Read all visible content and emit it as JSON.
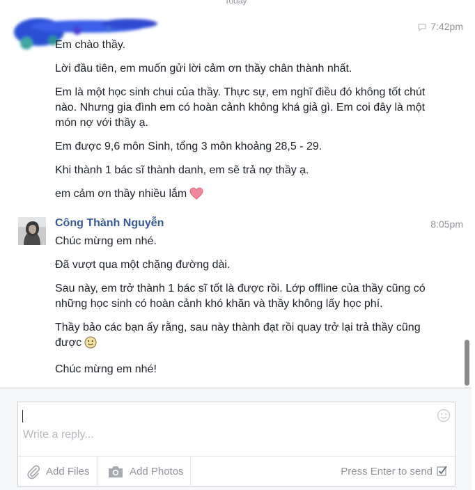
{
  "thread": {
    "day_separator": "Today",
    "messages": [
      {
        "sender": "",
        "time": "7:42pm",
        "lines": [
          "Em chào thầy.",
          "Lời đầu tiên, em muốn gửi lời cảm ơn thầy chân thành nhất.",
          "Em là một học sinh chui của thầy. Thực sự, em nghĩ điều đó không tốt chút nào. Nhưng gia đình em có hoàn cảnh không khá giả gì. Em coi đây là một món nợ với thầy ạ.",
          "Em được 9,6 môn Sinh, tổng 3 môn khoảng 28,5 - 29.",
          "Khi thành 1 bác sĩ thành danh, em sẽ trả nợ thầy ạ.",
          "em cảm ơn thầy nhiều lắm"
        ],
        "emoji_last_line": "heart-icon"
      },
      {
        "sender": "Công Thành Nguyễn",
        "time": "8:05pm",
        "lines": [
          "Chúc mừng em nhé.",
          "Đã vượt qua một chặng đường dài.",
          "Sau này, em trở thành 1 bác sĩ tốt là được rồi. Lớp offline của thầy cũng có những học sinh có hoàn cảnh khó khăn và thầy không lấy học phí.",
          "Thầy bảo các bạn ấy rằng, sau này thành đạt rồi quay trở lại trả thầy cũng được",
          "Chúc mừng em nhé!"
        ],
        "emoji_line_4": "smiley-icon"
      }
    ]
  },
  "composer": {
    "placeholder": "Write a reply...",
    "add_files": "Add Files",
    "add_photos": "Add Photos",
    "press_enter": "Press Enter to send",
    "press_enter_checked": true
  },
  "colors": {
    "sender_name": "#365899",
    "muted": "#90949c",
    "heart": "#f08a9a"
  }
}
